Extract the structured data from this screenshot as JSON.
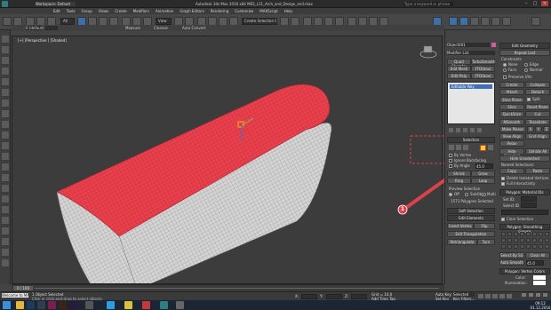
{
  "window": {
    "workspace_label": "Workspace: Default",
    "title": "Autodesk 3ds Max 2016 x64     MES_L11_Arch_and_Design_end.max",
    "search_placeholder": "Type a keyword or phrase"
  },
  "menus": [
    "Edit",
    "Tools",
    "Group",
    "Views",
    "Create",
    "Modifiers",
    "Animation",
    "Graph Editors",
    "Rendering",
    "Customize",
    "MAXScript",
    "Help"
  ],
  "toolbar": {
    "filter_value": "All",
    "selection_set": "Create Selection Se",
    "layer_value": "0 (default)",
    "view_dropdown": "View",
    "measure_label": "Measure",
    "cleanup_label": "Cleanse",
    "convert_label": "Auto Convert"
  },
  "viewport": {
    "label": "[+] [Perspective ] [Shaded]"
  },
  "command_panel": {
    "object_name": "Object001",
    "modifier_list": "Modifier List",
    "buttons_row1": [
      "Quad Chamfer",
      "TurboSmooth"
    ],
    "buttons_row2": [
      "Edit Mesh",
      "FFD(box)"
    ],
    "buttons_row3": [
      "Edit Poly",
      "FFD(box)"
    ],
    "stack_item": "Editable Poly",
    "selection_header": "Selection",
    "by_vertex": "By Vertex",
    "ignore_backfacing": "Ignore Backfacing",
    "by_angle": "By Angle",
    "angle_value": "45.0",
    "shrink": "Shrink",
    "grow": "Grow",
    "ring": "Ring",
    "loop": "Loop",
    "preview_selection": "Preview Selection",
    "preview_off": "Off",
    "subobj": "SubObj",
    "multi": "Multi",
    "selected_count": "1573 Polygons Selected",
    "soft_selection": "Soft Selection",
    "edit_elements": "Edit Elements",
    "insert_vertex": "Insert Vertex",
    "flip": "Flip",
    "edit_triangulation": "Edit Triangulation",
    "retriangulate": "Retriangulate",
    "turn": "Turn"
  },
  "geometry_panel": {
    "header": "Edit Geometry",
    "repeat_last": "Repeat Last",
    "constraints": "Constraints",
    "none": "None",
    "edge": "Edge",
    "face": "Face",
    "normal": "Normal",
    "preserve_uvs": "Preserve UVs",
    "create": "Create",
    "collapse": "Collapse",
    "attach": "Attach",
    "detach": "Detach",
    "slice_plane": "Slice Plane",
    "split": "Split",
    "slice": "Slice",
    "reset_plane": "Reset Plane",
    "quickslice": "QuickSlice",
    "cut": "Cut",
    "meshsmooth": "MSmooth",
    "tessellate": "Tessellate",
    "make_planar": "Make Planar",
    "x": "X",
    "y": "Y",
    "z": "Z",
    "view_align": "View Align",
    "grid_align": "Grid Align",
    "relax": "Relax",
    "hide_selected": "Hide Selected",
    "unhide_all": "Unhide All",
    "hide_unselected": "Hide Unselected",
    "named_selections": "Named Selections:",
    "copy": "Copy",
    "paste": "Paste",
    "delete_isolated": "Delete Isolated Vertices",
    "full_interactivity": "Full Interactivity",
    "poly_material_header": "Polygon: Material IDs",
    "set_id": "Set ID:",
    "select_id": "Select ID",
    "clear_selection": "Clear Selection",
    "smoothing_header": "Polygon: Smoothing Groups",
    "select_by_sg": "Select By SG",
    "clear_all": "Clear All",
    "auto_smooth": "Auto Smooth",
    "auto_smooth_value": "45.0",
    "vertex_colors_header": "Polygon: Vertex Colors",
    "color_label": "Color:",
    "illumination_label": "Illumination:"
  },
  "callout": {
    "number": "1"
  },
  "timeline": {
    "frame": "0 / 100"
  },
  "status": {
    "selected_text": "1 Object Selected",
    "prompt": "Click or click-and-drag to select objects",
    "welcome": "Welcome to MAX",
    "x_label": "X:",
    "y_label": "Y:",
    "z_label": "Z:",
    "grid": "Grid = 10.0",
    "add_time_tag": "Add Time Tag",
    "auto_key": "Auto Key",
    "set_key": "Set Key",
    "selected": "Selected",
    "key_filters": "Key Filters..."
  },
  "taskbar": {
    "time": "09:12",
    "date": "01.12.2016"
  },
  "colors": {
    "selection_red": "#e8404c",
    "callout_red": "#d9424d",
    "highlight_yellow": "#f2d21a"
  }
}
